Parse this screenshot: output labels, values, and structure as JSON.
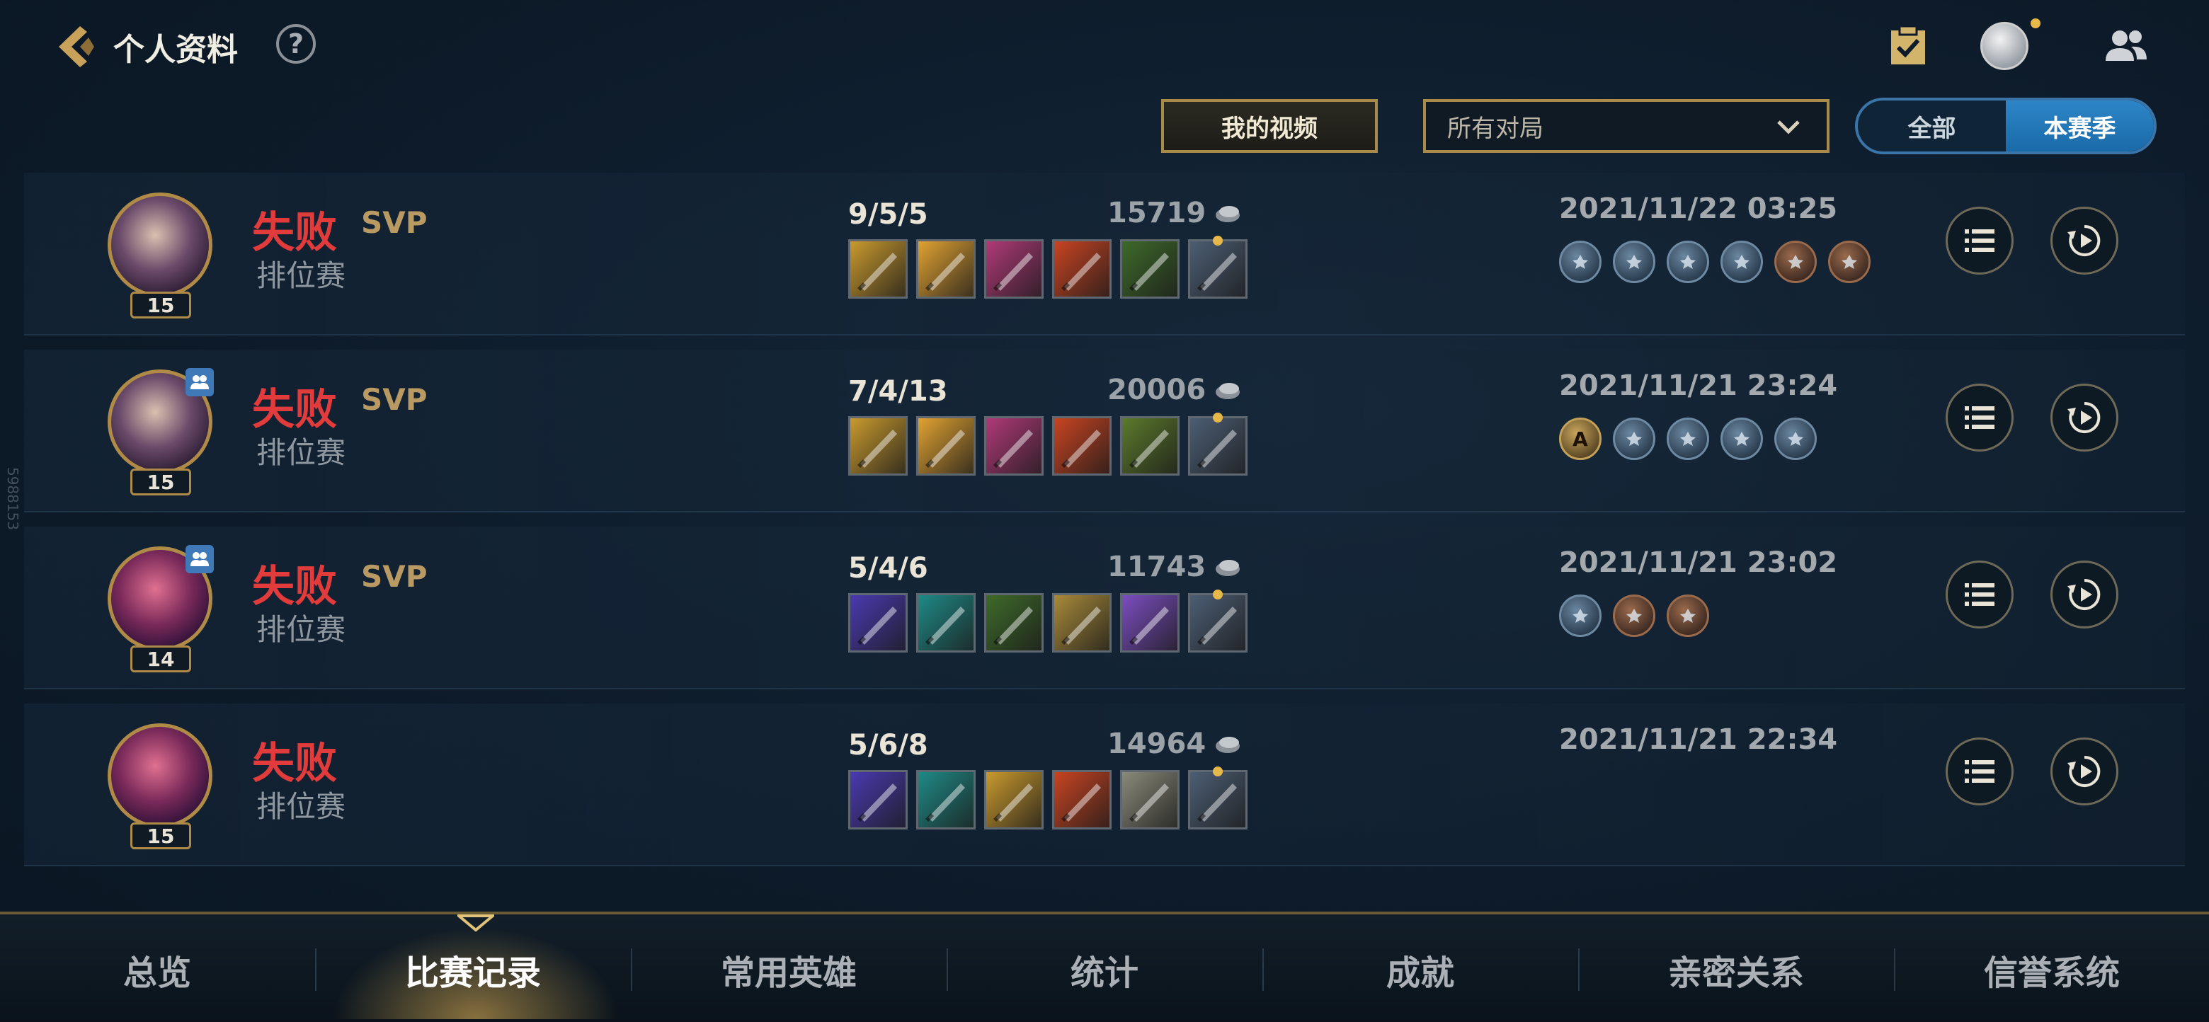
{
  "header": {
    "title": "个人资料",
    "help_label": "?"
  },
  "filters": {
    "video_label": "我的视频",
    "match_type_selected": "所有对局",
    "season_toggle": [
      {
        "label": "全部",
        "active": false
      },
      {
        "label": "本赛季",
        "active": true
      }
    ]
  },
  "side_watermark": "5988153",
  "matches": [
    {
      "level": "15",
      "result": "失败",
      "svp": "SVP",
      "mode": "排位赛",
      "kda": "9/5/5",
      "gold": "15719",
      "datetime": "2021/11/22 03:25",
      "team_badge": false,
      "items": [
        {
          "icon": "gold-sword-icon",
          "color": "#c99a2e"
        },
        {
          "icon": "lightning-blade-icon",
          "color": "#e0a232"
        },
        {
          "icon": "pink-blade-icon",
          "color": "#b03a78"
        },
        {
          "icon": "red-blade-icon",
          "color": "#c84422"
        },
        {
          "icon": "green-dagger-icon",
          "color": "#3e6a2a"
        },
        {
          "icon": "support-item-icon",
          "color": "#4c5e74"
        }
      ],
      "medals": [
        "blue",
        "blue",
        "blue",
        "blue",
        "bronze",
        "bronze"
      ]
    },
    {
      "level": "15",
      "result": "失败",
      "svp": "SVP",
      "mode": "排位赛",
      "kda": "7/4/13",
      "gold": "20006",
      "datetime": "2021/11/21 23:24",
      "team_badge": true,
      "items": [
        {
          "icon": "gold-sword-icon",
          "color": "#c99a2e"
        },
        {
          "icon": "lightning-blade-icon",
          "color": "#e0a232"
        },
        {
          "icon": "pink-blade-icon",
          "color": "#b03a78"
        },
        {
          "icon": "red-blade-icon",
          "color": "#c84422"
        },
        {
          "icon": "spiked-blade-icon",
          "color": "#5c7a2c"
        },
        {
          "icon": "support-item-icon",
          "color": "#4c5e74"
        }
      ],
      "medals": [
        "gold",
        "blue",
        "blue",
        "blue",
        "blue"
      ],
      "gold_medal_letter": "A"
    },
    {
      "level": "14",
      "result": "失败",
      "svp": "SVP",
      "mode": "排位赛",
      "kda": "5/4/6",
      "gold": "11743",
      "datetime": "2021/11/21 23:02",
      "team_badge": true,
      "items": [
        {
          "icon": "arcane-shard-icon",
          "color": "#4a3ab0"
        },
        {
          "icon": "teal-crystal-icon",
          "color": "#1f8a86"
        },
        {
          "icon": "green-dagger-icon",
          "color": "#3e6a2a"
        },
        {
          "icon": "golden-star-icon",
          "color": "#a88a3a"
        },
        {
          "icon": "violet-orb-icon",
          "color": "#7c4ec0"
        },
        {
          "icon": "support-item-icon",
          "color": "#4c5e74"
        }
      ],
      "medals": [
        "blue",
        "bronze",
        "bronze"
      ]
    },
    {
      "level": "15",
      "result": "失败",
      "svp": "",
      "mode": "排位赛",
      "kda": "5/6/8",
      "gold": "14964",
      "datetime": "2021/11/21 22:34",
      "team_badge": false,
      "items": [
        {
          "icon": "arcane-shard-icon",
          "color": "#4a3ab0"
        },
        {
          "icon": "teal-crystal-icon",
          "color": "#1f8a86"
        },
        {
          "icon": "gold-sword-icon",
          "color": "#c99a2e"
        },
        {
          "icon": "red-blade-icon",
          "color": "#c84422"
        },
        {
          "icon": "steel-blade-icon",
          "color": "#8a8a7a"
        },
        {
          "icon": "support-item-icon",
          "color": "#4c5e74"
        }
      ],
      "medals": []
    }
  ],
  "nav": {
    "tabs": [
      {
        "label": "总览",
        "active": false
      },
      {
        "label": "比赛记录",
        "active": true
      },
      {
        "label": "常用英雄",
        "active": false
      },
      {
        "label": "统计",
        "active": false
      },
      {
        "label": "成就",
        "active": false
      },
      {
        "label": "亲密关系",
        "active": false
      },
      {
        "label": "信誉系统",
        "active": false
      }
    ]
  },
  "colors": {
    "loss_red": "#e23b3b",
    "gold_accent": "#b08b48",
    "active_blue": "#2d86c8"
  }
}
